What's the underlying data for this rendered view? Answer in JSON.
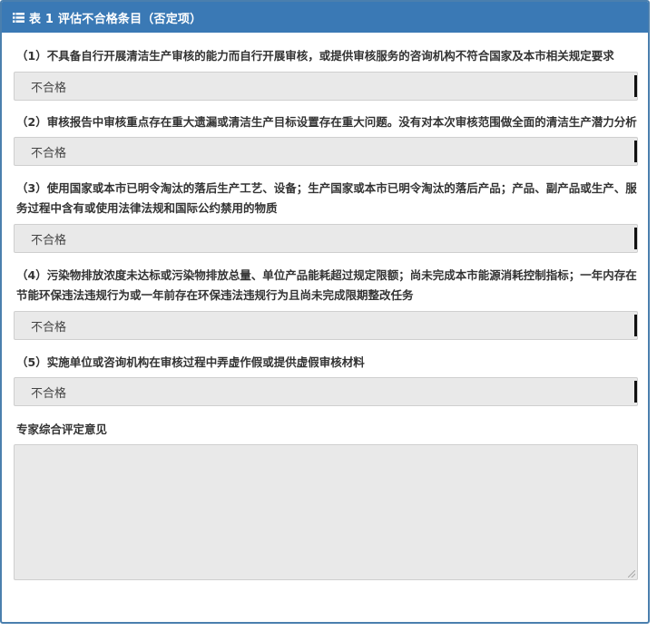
{
  "panel": {
    "title": "表 1 评估不合格条目（否定项）",
    "header_color": "#3a79b5",
    "icon": "list-icon"
  },
  "items": [
    {
      "question": "（1）不具备自行开展清洁生产审核的能力而自行开展审核，或提供审核服务的咨询机构不符合国家及本市相关规定要求",
      "selected": "不合格"
    },
    {
      "question": "（2）审核报告中审核重点存在重大遗漏或清洁生产目标设置存在重大问题。没有对本次审核范围做全面的清洁生产潜力分析",
      "selected": "不合格"
    },
    {
      "question": "（3）使用国家或本市已明令淘汰的落后生产工艺、设备；生产国家或本市已明令淘汰的落后产品；产品、副产品或生产、服务过程中含有或使用法律法规和国际公约禁用的物质",
      "selected": "不合格"
    },
    {
      "question": "（4）污染物排放浓度未达标或污染物排放总量、单位产品能耗超过规定限额；尚未完成本市能源消耗控制指标；一年内存在节能环保违法违规行为或一年前存在环保违法违规行为且尚未完成限期整改任务",
      "selected": "不合格"
    },
    {
      "question": "（5）实施单位或咨询机构在审核过程中弄虚作假或提供虚假审核材料",
      "selected": "不合格"
    }
  ],
  "comment": {
    "label": "专家综合评定意见",
    "value": ""
  }
}
